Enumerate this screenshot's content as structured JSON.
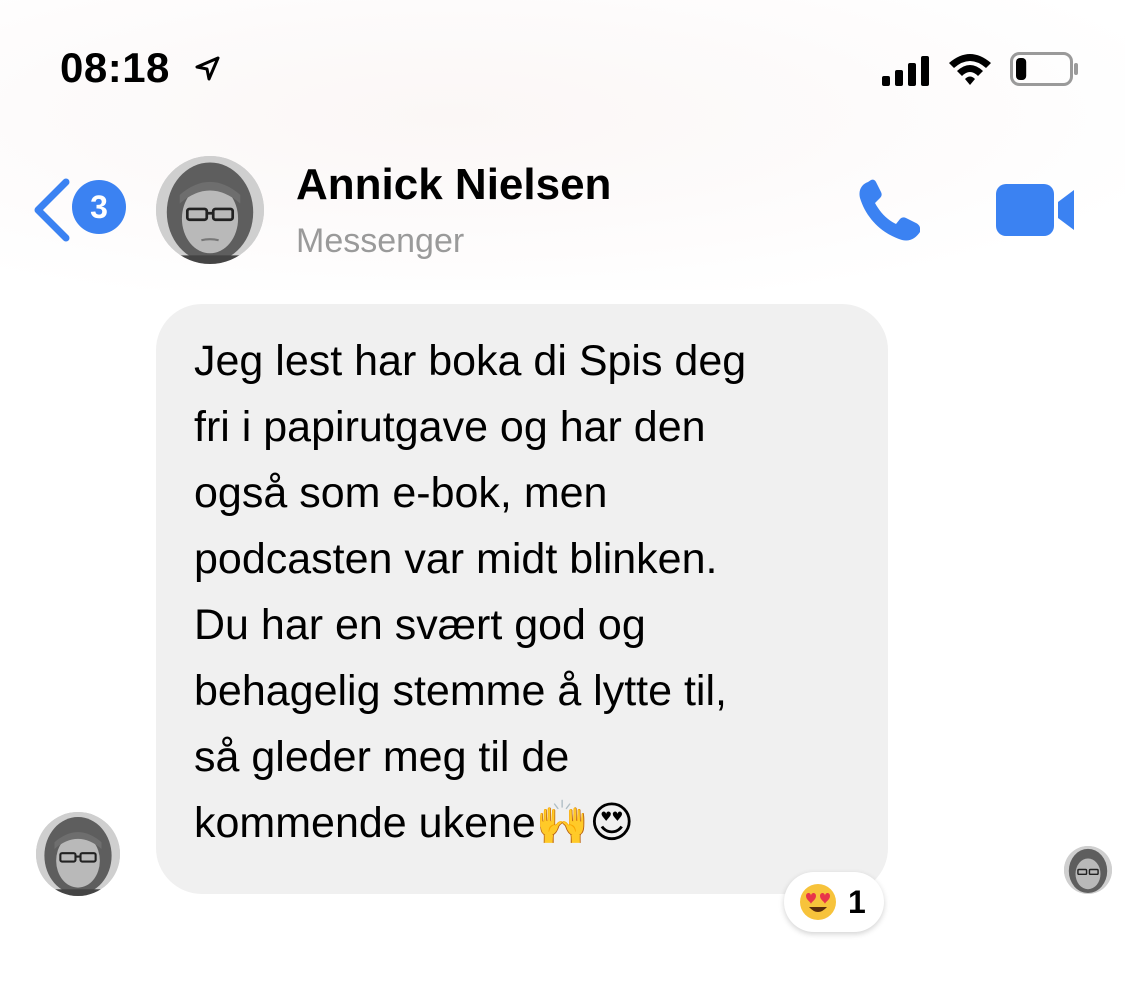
{
  "status_bar": {
    "time": "08:18",
    "location_icon": "location-arrow-icon",
    "signal_icon": "cellular-signal-icon",
    "wifi_icon": "wifi-icon",
    "battery_icon": "battery-low-icon",
    "battery_level": 0.2
  },
  "header": {
    "back_icon": "chevron-left-icon",
    "unread_count": "3",
    "contact_name": "Annick Nielsen",
    "contact_subtitle": "Messenger",
    "call_icon": "phone-icon",
    "video_icon": "video-camera-icon",
    "accent_color": "#3b82f2"
  },
  "message": {
    "text": "Jeg lest har boka di Spis deg\nfri i papirutgave og har den\nogså som e-bok, men\npodcasten var midt blinken.\nDu har en svært god og\nbehagelig stemme å lytte til,\nså gleder meg til de\nkommende ukene🙌😍",
    "bubble_color": "#f0f0f0",
    "reaction": {
      "emoji": "😍",
      "icon": "heart-eyes-emoji-icon",
      "count": "1"
    }
  }
}
